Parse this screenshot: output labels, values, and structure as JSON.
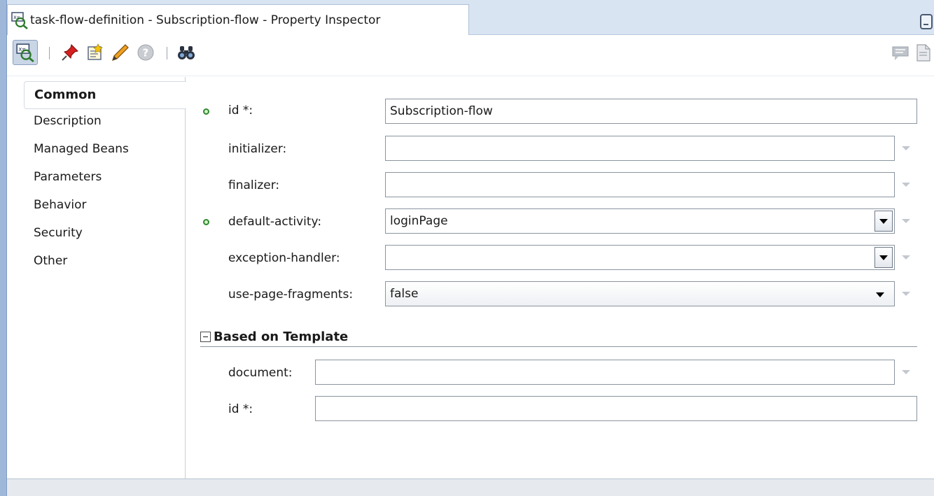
{
  "window": {
    "title": "task-flow-definition - Subscription-flow - Property Inspector",
    "tab_icon": "property-inspector-icon",
    "minimize_icon": "minimize-icon"
  },
  "toolbar": {
    "left_buttons": [
      {
        "icon": "property-inspector-icon",
        "pressed": true
      },
      {
        "icon": "pin-icon"
      },
      {
        "icon": "edit-properties-icon"
      },
      {
        "icon": "pencil-icon"
      },
      {
        "icon": "help-icon"
      },
      {
        "icon": "binoculars-find-icon"
      }
    ],
    "right_buttons": [
      {
        "icon": "comment-icon"
      },
      {
        "icon": "document-icon"
      }
    ]
  },
  "nav": {
    "items": [
      {
        "label": "Common",
        "selected": true
      },
      {
        "label": "Description"
      },
      {
        "label": "Managed Beans"
      },
      {
        "label": "Parameters"
      },
      {
        "label": "Behavior"
      },
      {
        "label": "Security"
      },
      {
        "label": "Other"
      }
    ]
  },
  "form": {
    "fields": [
      {
        "label": "id *:",
        "value": "Subscription-flow",
        "required": true,
        "type": "text"
      },
      {
        "label": "initializer:",
        "value": "",
        "type": "text"
      },
      {
        "label": "finalizer:",
        "value": "",
        "type": "text"
      },
      {
        "label": "default-activity:",
        "value": "loginPage",
        "required": true,
        "type": "combo"
      },
      {
        "label": "exception-handler:",
        "value": "",
        "type": "combo"
      },
      {
        "label": "use-page-fragments:",
        "value": "false",
        "type": "select"
      }
    ],
    "template_section": {
      "title": "Based on Template",
      "collapsed": false,
      "fields": [
        {
          "label": "document:",
          "value": "",
          "type": "text"
        },
        {
          "label": "id *:",
          "value": "",
          "type": "text"
        }
      ]
    }
  },
  "colors": {
    "window_edge": "#9fb7d9",
    "tab_bar": "#d9e4f3",
    "required_dot": "#2f8a2f"
  }
}
